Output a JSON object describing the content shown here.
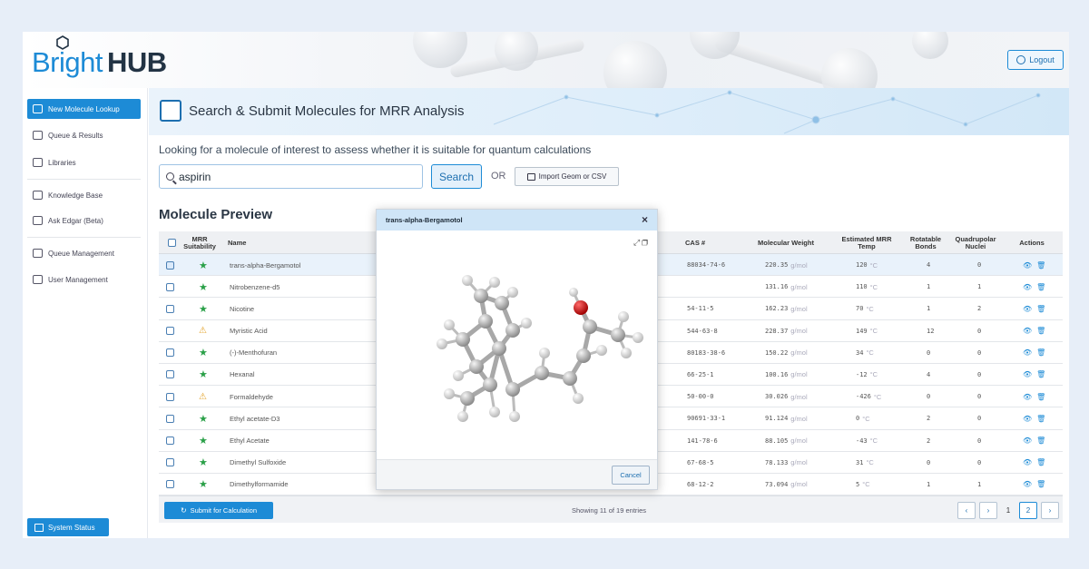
{
  "brand": {
    "name_part1": "Bright",
    "name_part2": "HUB"
  },
  "header": {
    "logout_label": "Logout"
  },
  "sidebar": {
    "items": [
      {
        "label": "New Molecule Lookup",
        "icon": "flask-icon",
        "active": true
      },
      {
        "label": "Queue & Results",
        "icon": "queue-icon"
      },
      {
        "label": "Libraries",
        "icon": "library-icon"
      },
      {
        "label": "Knowledge Base",
        "icon": "external-link-icon"
      },
      {
        "label": "Ask Edgar (Beta)",
        "icon": "external-link-icon"
      },
      {
        "label": "Queue Management",
        "icon": "queue-icon"
      },
      {
        "label": "User Management",
        "icon": "users-icon"
      }
    ],
    "system_status_label": "System Status"
  },
  "banner": {
    "title": "Search & Submit Molecules for MRR Analysis"
  },
  "lookup": {
    "description": "Looking for a molecule of interest to assess whether it is suitable for quantum calculations",
    "search_value": "aspirin",
    "search_button": "Search",
    "or_label": "OR",
    "import_button": "Import Geom or CSV"
  },
  "preview": {
    "title": "Molecule Preview",
    "columns": {
      "suitability": "MRR Suitability",
      "name": "Name",
      "cas": "CAS #",
      "mw": "Molecular Weight",
      "temp": "Estimated MRR Temp",
      "rot": "Rotatable Bonds",
      "quad": "Quadrupolar Nuclei",
      "actions": "Actions"
    },
    "mw_unit": "g/mol",
    "temp_unit": "°C",
    "rows": [
      {
        "checked": true,
        "suitability": "suitable",
        "name": "trans-alpha-Bergamotol",
        "cas": "88034-74-6",
        "mw": "220.35",
        "temp": "120",
        "rot": "4",
        "quad": "0"
      },
      {
        "checked": false,
        "suitability": "suitable",
        "name": "Nitrobenzene-d5",
        "cas": "",
        "mw": "131.16",
        "temp": "110",
        "rot": "1",
        "quad": "1"
      },
      {
        "checked": false,
        "suitability": "suitable",
        "name": "Nicotine",
        "cas": "54-11-5",
        "mw": "162.23",
        "temp": "70",
        "rot": "1",
        "quad": "2"
      },
      {
        "checked": false,
        "suitability": "warning",
        "name": "Myristic Acid",
        "cas": "544-63-8",
        "mw": "228.37",
        "temp": "149",
        "rot": "12",
        "quad": "0"
      },
      {
        "checked": false,
        "suitability": "suitable",
        "name": "(-)-Menthofuran",
        "cas": "80183-38-6",
        "mw": "150.22",
        "temp": "34",
        "rot": "0",
        "quad": "0"
      },
      {
        "checked": false,
        "suitability": "suitable",
        "name": "Hexanal",
        "cas": "66-25-1",
        "mw": "100.16",
        "temp": "-12",
        "rot": "4",
        "quad": "0"
      },
      {
        "checked": false,
        "suitability": "warning",
        "name": "Formaldehyde",
        "cas": "50-00-0",
        "mw": "30.026",
        "temp": "-426",
        "rot": "0",
        "quad": "0"
      },
      {
        "checked": false,
        "suitability": "suitable",
        "name": "Ethyl acetate-D3",
        "cas": "90691-33-1",
        "mw": "91.124",
        "temp": "0",
        "rot": "2",
        "quad": "0"
      },
      {
        "checked": false,
        "suitability": "suitable",
        "name": "Ethyl Acetate",
        "cas": "141-78-6",
        "mw": "88.105",
        "temp": "-43",
        "rot": "2",
        "quad": "0"
      },
      {
        "checked": false,
        "suitability": "suitable",
        "name": "Dimethyl Sulfoxide",
        "cas": "67-68-5",
        "mw": "78.133",
        "temp": "31",
        "rot": "0",
        "quad": "0"
      },
      {
        "checked": false,
        "suitability": "suitable",
        "name": "Dimethylformamide",
        "cas": "68-12-2",
        "mw": "73.094",
        "temp": "5",
        "rot": "1",
        "quad": "1"
      }
    ],
    "submit_button": "Submit for Calculation",
    "showing_text": "Showing 11 of 19 entries",
    "pages": [
      "1",
      "2"
    ],
    "current_page": "2"
  },
  "modal": {
    "title": "trans-alpha-Bergamotol",
    "close": "×",
    "cancel_button": "Cancel"
  },
  "colors": {
    "accent": "#1d8bd6",
    "suitable": "#2aa048",
    "warning": "#e3a32b",
    "oxygen": "#cc1f1f"
  }
}
